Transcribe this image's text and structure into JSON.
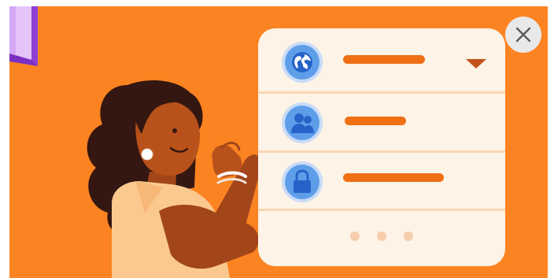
{
  "colors": {
    "background": "#fc8321",
    "card": "#fdf3e7",
    "bar_accent": "#ef6f14",
    "icon_blue": "#5e9ee9",
    "icon_blue_light": "#c9dbf8",
    "close_button": "#e9e9e9",
    "skin": "#b9521a",
    "hair": "#341711",
    "shirt": "#fbc98e",
    "corner_tab": "#8f3fd6"
  },
  "close_button": {
    "icon": "close-icon",
    "label": "Close"
  },
  "settings_card": {
    "rows": [
      {
        "icon": "globe-icon",
        "has_dropdown": true
      },
      {
        "icon": "people-icon",
        "has_dropdown": false
      },
      {
        "icon": "lock-icon",
        "has_dropdown": false
      }
    ],
    "pager_dots": 3
  }
}
